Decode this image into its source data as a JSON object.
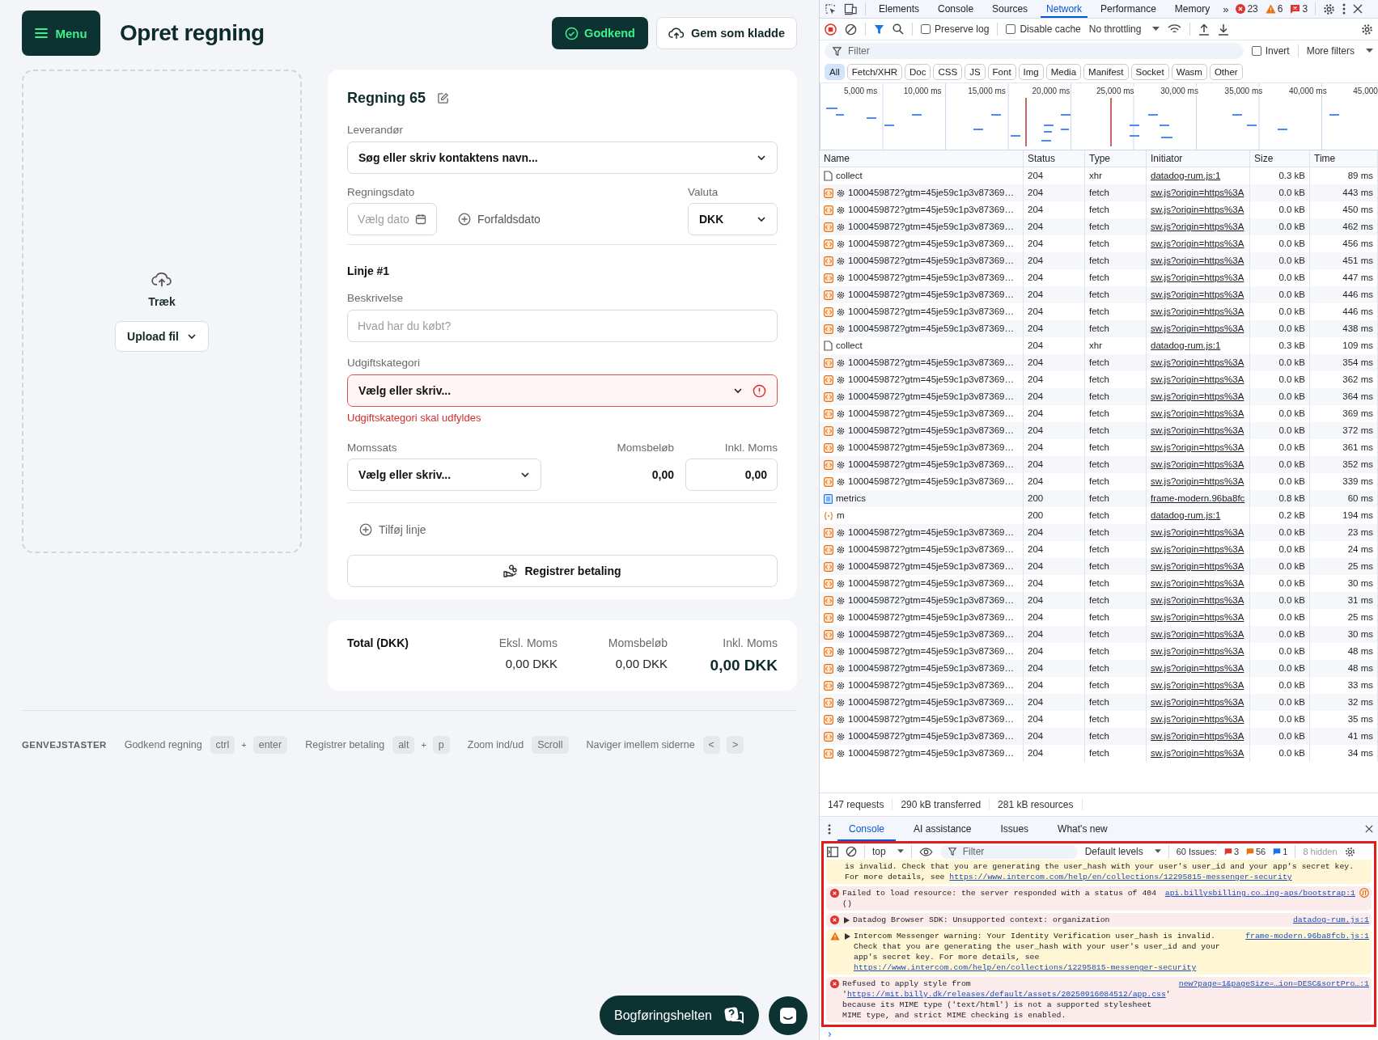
{
  "app": {
    "menu_button": "Menu",
    "title": "Opret regning",
    "approve_button": "Godkend",
    "draft_button": "Gem som kladde",
    "dropzone": {
      "label": "Træk",
      "upload_button": "Upload fil"
    },
    "bill": {
      "title": "Regning 65",
      "supplier_label": "Leverandør",
      "supplier_value": "Søg eller skriv kontaktens navn...",
      "date_label": "Regningsdato",
      "date_placeholder": "Vælg dato",
      "due_date_button": "Forfaldsdato",
      "currency_label": "Valuta",
      "currency_value": "DKK",
      "line_title": "Linje #1",
      "description_label": "Beskrivelse",
      "description_placeholder": "Hvad har du købt?",
      "category_label": "Udgiftskategori",
      "category_value": "Vælg eller skriv...",
      "category_error": true,
      "category_error_text": "Udgiftskategori skal udfyldes",
      "vat_label": "Momssats",
      "vat_value": "Vælg eller skriv...",
      "vat_amount_label": "Momsbeløb",
      "vat_amount": "0,00",
      "incl_label": "Inkl. Moms",
      "incl_value": "0,00",
      "add_line": "Tilføj linje",
      "register_payment": "Registrer betaling"
    },
    "totals": {
      "title": "Total (DKK)",
      "columns": [
        {
          "label": "Eksl. Moms",
          "value": "0,00 DKK",
          "emphasis": false
        },
        {
          "label": "Momsbeløb",
          "value": "0,00 DKK",
          "emphasis": false
        },
        {
          "label": "Inkl. Moms",
          "value": "0,00 DKK",
          "emphasis": true
        }
      ]
    },
    "shortcuts": {
      "title": "GENVEJSTASTER",
      "items": [
        {
          "label": "Godkend regning",
          "parts": [
            {
              "kind": "key",
              "text": "ctrl"
            },
            {
              "kind": "plus",
              "text": "+"
            },
            {
              "kind": "key",
              "text": "enter"
            }
          ]
        },
        {
          "label": "Registrer betaling",
          "parts": [
            {
              "kind": "key",
              "text": "alt"
            },
            {
              "kind": "plus",
              "text": "+"
            },
            {
              "kind": "key",
              "text": "p"
            }
          ]
        },
        {
          "label": "Zoom ind/ud",
          "parts": [
            {
              "kind": "key",
              "text": "Scroll"
            }
          ]
        },
        {
          "label": "Naviger imellem siderne",
          "parts": [
            {
              "kind": "key",
              "text": "<"
            },
            {
              "kind": "key",
              "text": ">"
            }
          ]
        }
      ]
    },
    "help_button": "Bogføringshelten"
  },
  "devtools": {
    "tabs": [
      {
        "label": "Elements",
        "selected": false
      },
      {
        "label": "Console",
        "selected": false
      },
      {
        "label": "Sources",
        "selected": false
      },
      {
        "label": "Network",
        "selected": true
      },
      {
        "label": "Performance",
        "selected": false
      },
      {
        "label": "Memory",
        "selected": false
      }
    ],
    "more_tabs": "»",
    "counters": [
      {
        "kind": "error",
        "count": "23"
      },
      {
        "kind": "warning",
        "count": "6"
      },
      {
        "kind": "issue",
        "count": "3"
      }
    ],
    "preserve_log": {
      "label": "Preserve log",
      "checked": false
    },
    "disable_cache": {
      "label": "Disable cache",
      "checked": false
    },
    "throttling": "No throttling",
    "filter_placeholder": "Filter",
    "invert": {
      "label": "Invert",
      "checked": false
    },
    "more_filters": "More filters",
    "type_filters": [
      {
        "label": "All",
        "selected": true
      },
      {
        "label": "Fetch/XHR",
        "selected": false
      },
      {
        "label": "Doc",
        "selected": false
      },
      {
        "label": "CSS",
        "selected": false
      },
      {
        "label": "JS",
        "selected": false
      },
      {
        "label": "Font",
        "selected": false
      },
      {
        "label": "Img",
        "selected": false
      },
      {
        "label": "Media",
        "selected": false
      },
      {
        "label": "Manifest",
        "selected": false
      },
      {
        "label": "Socket",
        "selected": false
      },
      {
        "label": "Wasm",
        "selected": false
      },
      {
        "label": "Other",
        "selected": false
      }
    ],
    "timeline_ticks": [
      "5,000 ms",
      "10,000 ms",
      "15,000 ms",
      "20,000 ms",
      "25,000 ms",
      "30,000 ms",
      "35,000 ms",
      "40,000 ms",
      "45,000"
    ],
    "columns": [
      "Name",
      "Status",
      "Type",
      "Initiator",
      "Size",
      "Time"
    ],
    "rows": [
      {
        "kind": "doc",
        "name": "collect",
        "status": "204",
        "type": "xhr",
        "initiator": "datadog-rum.js:1",
        "size": "0.3 kB",
        "time": "89 ms"
      },
      {
        "kind": "fetch",
        "name": "1000459872?gtm=45je59c1p3v87369…",
        "status": "204",
        "type": "fetch",
        "initiator": "sw.js?origin=https%3A",
        "size": "0.0 kB",
        "time": "443 ms"
      },
      {
        "kind": "fetch",
        "name": "1000459872?gtm=45je59c1p3v87369…",
        "status": "204",
        "type": "fetch",
        "initiator": "sw.js?origin=https%3A",
        "size": "0.0 kB",
        "time": "450 ms"
      },
      {
        "kind": "fetch",
        "name": "1000459872?gtm=45je59c1p3v87369…",
        "status": "204",
        "type": "fetch",
        "initiator": "sw.js?origin=https%3A",
        "size": "0.0 kB",
        "time": "462 ms"
      },
      {
        "kind": "fetch",
        "name": "1000459872?gtm=45je59c1p3v87369…",
        "status": "204",
        "type": "fetch",
        "initiator": "sw.js?origin=https%3A",
        "size": "0.0 kB",
        "time": "456 ms"
      },
      {
        "kind": "fetch",
        "name": "1000459872?gtm=45je59c1p3v87369…",
        "status": "204",
        "type": "fetch",
        "initiator": "sw.js?origin=https%3A",
        "size": "0.0 kB",
        "time": "451 ms"
      },
      {
        "kind": "fetch",
        "name": "1000459872?gtm=45je59c1p3v87369…",
        "status": "204",
        "type": "fetch",
        "initiator": "sw.js?origin=https%3A",
        "size": "0.0 kB",
        "time": "447 ms"
      },
      {
        "kind": "fetch",
        "name": "1000459872?gtm=45je59c1p3v87369…",
        "status": "204",
        "type": "fetch",
        "initiator": "sw.js?origin=https%3A",
        "size": "0.0 kB",
        "time": "446 ms"
      },
      {
        "kind": "fetch",
        "name": "1000459872?gtm=45je59c1p3v87369…",
        "status": "204",
        "type": "fetch",
        "initiator": "sw.js?origin=https%3A",
        "size": "0.0 kB",
        "time": "446 ms"
      },
      {
        "kind": "fetch",
        "name": "1000459872?gtm=45je59c1p3v87369…",
        "status": "204",
        "type": "fetch",
        "initiator": "sw.js?origin=https%3A",
        "size": "0.0 kB",
        "time": "438 ms"
      },
      {
        "kind": "doc",
        "name": "collect",
        "status": "204",
        "type": "xhr",
        "initiator": "datadog-rum.js:1",
        "size": "0.3 kB",
        "time": "109 ms"
      },
      {
        "kind": "fetch",
        "name": "1000459872?gtm=45je59c1p3v87369…",
        "status": "204",
        "type": "fetch",
        "initiator": "sw.js?origin=https%3A",
        "size": "0.0 kB",
        "time": "354 ms"
      },
      {
        "kind": "fetch",
        "name": "1000459872?gtm=45je59c1p3v87369…",
        "status": "204",
        "type": "fetch",
        "initiator": "sw.js?origin=https%3A",
        "size": "0.0 kB",
        "time": "362 ms"
      },
      {
        "kind": "fetch",
        "name": "1000459872?gtm=45je59c1p3v87369…",
        "status": "204",
        "type": "fetch",
        "initiator": "sw.js?origin=https%3A",
        "size": "0.0 kB",
        "time": "364 ms"
      },
      {
        "kind": "fetch",
        "name": "1000459872?gtm=45je59c1p3v87369…",
        "status": "204",
        "type": "fetch",
        "initiator": "sw.js?origin=https%3A",
        "size": "0.0 kB",
        "time": "369 ms"
      },
      {
        "kind": "fetch",
        "name": "1000459872?gtm=45je59c1p3v87369…",
        "status": "204",
        "type": "fetch",
        "initiator": "sw.js?origin=https%3A",
        "size": "0.0 kB",
        "time": "372 ms"
      },
      {
        "kind": "fetch",
        "name": "1000459872?gtm=45je59c1p3v87369…",
        "status": "204",
        "type": "fetch",
        "initiator": "sw.js?origin=https%3A",
        "size": "0.0 kB",
        "time": "361 ms"
      },
      {
        "kind": "fetch",
        "name": "1000459872?gtm=45je59c1p3v87369…",
        "status": "204",
        "type": "fetch",
        "initiator": "sw.js?origin=https%3A",
        "size": "0.0 kB",
        "time": "352 ms"
      },
      {
        "kind": "fetch",
        "name": "1000459872?gtm=45je59c1p3v87369…",
        "status": "204",
        "type": "fetch",
        "initiator": "sw.js?origin=https%3A",
        "size": "0.0 kB",
        "time": "339 ms"
      },
      {
        "kind": "metrics",
        "name": "metrics",
        "status": "200",
        "type": "fetch",
        "initiator": "frame-modern.96ba8fc",
        "size": "0.8 kB",
        "time": "60 ms"
      },
      {
        "kind": "script",
        "name": "m",
        "status": "200",
        "type": "fetch",
        "initiator": "datadog-rum.js:1",
        "size": "0.2 kB",
        "time": "194 ms"
      },
      {
        "kind": "fetch",
        "name": "1000459872?gtm=45je59c1p3v87369…",
        "status": "204",
        "type": "fetch",
        "initiator": "sw.js?origin=https%3A",
        "size": "0.0 kB",
        "time": "23 ms"
      },
      {
        "kind": "fetch",
        "name": "1000459872?gtm=45je59c1p3v87369…",
        "status": "204",
        "type": "fetch",
        "initiator": "sw.js?origin=https%3A",
        "size": "0.0 kB",
        "time": "24 ms"
      },
      {
        "kind": "fetch",
        "name": "1000459872?gtm=45je59c1p3v87369…",
        "status": "204",
        "type": "fetch",
        "initiator": "sw.js?origin=https%3A",
        "size": "0.0 kB",
        "time": "25 ms"
      },
      {
        "kind": "fetch",
        "name": "1000459872?gtm=45je59c1p3v87369…",
        "status": "204",
        "type": "fetch",
        "initiator": "sw.js?origin=https%3A",
        "size": "0.0 kB",
        "time": "30 ms"
      },
      {
        "kind": "fetch",
        "name": "1000459872?gtm=45je59c1p3v87369…",
        "status": "204",
        "type": "fetch",
        "initiator": "sw.js?origin=https%3A",
        "size": "0.0 kB",
        "time": "31 ms"
      },
      {
        "kind": "fetch",
        "name": "1000459872?gtm=45je59c1p3v87369…",
        "status": "204",
        "type": "fetch",
        "initiator": "sw.js?origin=https%3A",
        "size": "0.0 kB",
        "time": "25 ms"
      },
      {
        "kind": "fetch",
        "name": "1000459872?gtm=45je59c1p3v87369…",
        "status": "204",
        "type": "fetch",
        "initiator": "sw.js?origin=https%3A",
        "size": "0.0 kB",
        "time": "30 ms"
      },
      {
        "kind": "fetch",
        "name": "1000459872?gtm=45je59c1p3v87369…",
        "status": "204",
        "type": "fetch",
        "initiator": "sw.js?origin=https%3A",
        "size": "0.0 kB",
        "time": "48 ms"
      },
      {
        "kind": "fetch",
        "name": "1000459872?gtm=45je59c1p3v87369…",
        "status": "204",
        "type": "fetch",
        "initiator": "sw.js?origin=https%3A",
        "size": "0.0 kB",
        "time": "48 ms"
      },
      {
        "kind": "fetch",
        "name": "1000459872?gtm=45je59c1p3v87369…",
        "status": "204",
        "type": "fetch",
        "initiator": "sw.js?origin=https%3A",
        "size": "0.0 kB",
        "time": "33 ms"
      },
      {
        "kind": "fetch",
        "name": "1000459872?gtm=45je59c1p3v87369…",
        "status": "204",
        "type": "fetch",
        "initiator": "sw.js?origin=https%3A",
        "size": "0.0 kB",
        "time": "32 ms"
      },
      {
        "kind": "fetch",
        "name": "1000459872?gtm=45je59c1p3v87369…",
        "status": "204",
        "type": "fetch",
        "initiator": "sw.js?origin=https%3A",
        "size": "0.0 kB",
        "time": "35 ms"
      },
      {
        "kind": "fetch",
        "name": "1000459872?gtm=45je59c1p3v87369…",
        "status": "204",
        "type": "fetch",
        "initiator": "sw.js?origin=https%3A",
        "size": "0.0 kB",
        "time": "41 ms"
      },
      {
        "kind": "fetch",
        "name": "1000459872?gtm=45je59c1p3v87369…",
        "status": "204",
        "type": "fetch",
        "initiator": "sw.js?origin=https%3A",
        "size": "0.0 kB",
        "time": "34 ms"
      }
    ],
    "summary": [
      "147 requests",
      "290 kB transferred",
      "281 kB resources"
    ],
    "drawer_tabs": [
      {
        "label": "Console",
        "selected": true
      },
      {
        "label": "AI assistance",
        "selected": false
      },
      {
        "label": "Issues",
        "selected": false
      },
      {
        "label": "What's new",
        "selected": false
      }
    ],
    "console": {
      "highlighted": true,
      "context": "top",
      "filter_placeholder": "Filter",
      "levels": "Default levels",
      "issues_label": "60 Issues:",
      "issue_counts": [
        {
          "kind": "error",
          "count": "3"
        },
        {
          "kind": "warning",
          "count": "56"
        },
        {
          "kind": "info",
          "count": "1"
        }
      ],
      "hidden": "8 hidden",
      "messages": [
        {
          "kind": "warning",
          "continued": true,
          "expandable": false,
          "segments": [
            {
              "kind": "text",
              "text": "is invalid. Check that you are generating the user_hash with your user's user_id and your app's secret key. For more details, see "
            },
            {
              "kind": "link",
              "text": "https://www.intercom.com/help/en/collections/12295815-messenger-security"
            }
          ]
        },
        {
          "kind": "error",
          "continued": false,
          "expandable": false,
          "network": true,
          "source": "api.billysbilling.co…ing-aps/bootstrap:1",
          "segments": [
            {
              "kind": "text",
              "text": "Failed to load resource: the server responded with a status of 404 ()"
            }
          ]
        },
        {
          "kind": "error",
          "continued": false,
          "expandable": true,
          "source": "datadog-rum.js:1",
          "segments": [
            {
              "kind": "text",
              "text": "Datadog Browser SDK: Unsupported context: organization"
            }
          ]
        },
        {
          "kind": "warning",
          "continued": false,
          "expandable": true,
          "source": "frame-modern.96ba8fcb.js:1",
          "segments": [
            {
              "kind": "text",
              "text": "Intercom Messenger warning: Your Identity Verification user_hash is invalid. Check that you are generating the user_hash with your user's user_id and your app's secret key. For more details, see "
            },
            {
              "kind": "link",
              "text": "https://www.intercom.com/help/en/collections/12295815-messenger-security"
            }
          ]
        },
        {
          "kind": "error",
          "continued": false,
          "expandable": false,
          "source": "new?page=1&pageSize=…ion=DESC&sortPro…:1",
          "segments": [
            {
              "kind": "text",
              "text": "Refused to apply style from '"
            },
            {
              "kind": "link",
              "text": "https://mit.billy.dk/releases/default/assets/20250916084512/app.css"
            },
            {
              "kind": "text",
              "text": "' because its MIME type ('text/html') is not a supported stylesheet MIME type, and strict MIME checking is enabled."
            }
          ]
        }
      ],
      "prompt": "›"
    }
  }
}
